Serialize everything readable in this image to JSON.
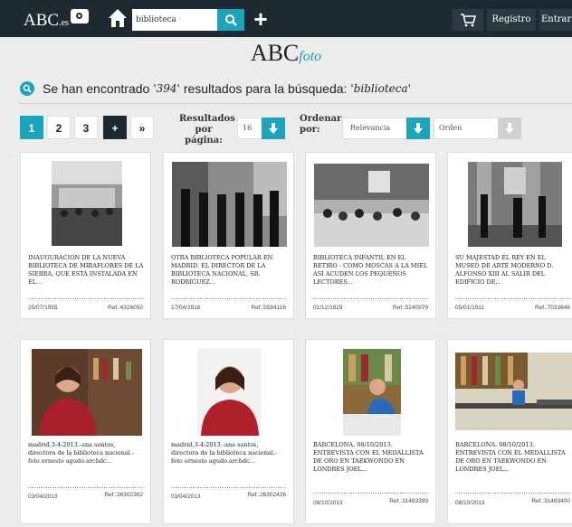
{
  "header": {
    "logo_text": "ABC",
    "logo_suffix": ".es",
    "search_value": "biblioteca",
    "registro_label": "Registro",
    "entrar_label": "Entrar"
  },
  "brand": {
    "name": "ABC",
    "sub": "foto"
  },
  "results": {
    "prefix": "Se han encontrado",
    "count": "'394'",
    "middle": "resultados para la búsqueda:",
    "query": "'biblioteca'"
  },
  "pagination": {
    "p1": "1",
    "p2": "2",
    "p3": "3",
    "more": "+",
    "next": "»"
  },
  "filters": {
    "per_page_label_1": "Resultados",
    "per_page_label_2": "por página:",
    "per_page_value": "16",
    "order_label_1": "Ordenar",
    "order_label_2": "por:",
    "order_value": "Relevancia",
    "direction_value": "Orden"
  },
  "cards": [
    {
      "desc": "INAUGURACION DE LA NUEVA BIBLIOTECA DE MIRAFLORES DE LA SIERRA, QUE ESTÁ INSTALADA EN EL...",
      "date": "25/07/1955",
      "ref": "Ref.:4326050"
    },
    {
      "desc": "OTRA BIBLIOTECA POPULAR EN MADRID. EL DIRECTOR DE LA BIBLIOTECA NACIONAL, SR. RODRÍGUEZ...",
      "date": "17/04/1916",
      "ref": "Ref.:5584116"
    },
    {
      "desc": "BIBLIOTECA INFANTIL EN EL RETIRO - COMO MOSCAS A LA MIEL ASÍ ACUDEN LOS PEQUEÑOS LECTORES...",
      "date": "01/12/1929",
      "ref": "Ref.:5240979"
    },
    {
      "desc": "SU MAJESTAD EL REY EN EL MUSEO DE ARTE MODERNO D. ALFONSO XIII AL SALIR DEL EDIFICIO DE...",
      "date": "05/01/1911",
      "ref": "Ref.:7033646"
    },
    {
      "desc": "madrid,3-4-2013.-ana santos, directora de la biblioteca nacional.-foto ernesto agudo.archdc...",
      "date": "03/04/2013",
      "ref": "Ref.:26302362"
    },
    {
      "desc": "madrid,3-4-2013.-ana santos, directora de la biblioteca nacional.-foto ernesto agudo.archdc...",
      "date": "03/04/2013",
      "ref": "Ref.:26302426"
    },
    {
      "desc": "BARCELONA. 08/10/2013. ENTREVISTA CON EL MEDALLISTA DE ORO EN TAEKWONDO EN LONDRES JOEL...",
      "date": "08/10/2013",
      "ref": "Ref.:31483399"
    },
    {
      "desc": "BARCELONA. 08/10/2013. ENTREVISTA CON EL MEDALLISTA DE ORO EN TAEKWONDO EN LONDRES JOEL...",
      "date": "08/10/2013",
      "ref": "Ref.:31483400"
    }
  ]
}
